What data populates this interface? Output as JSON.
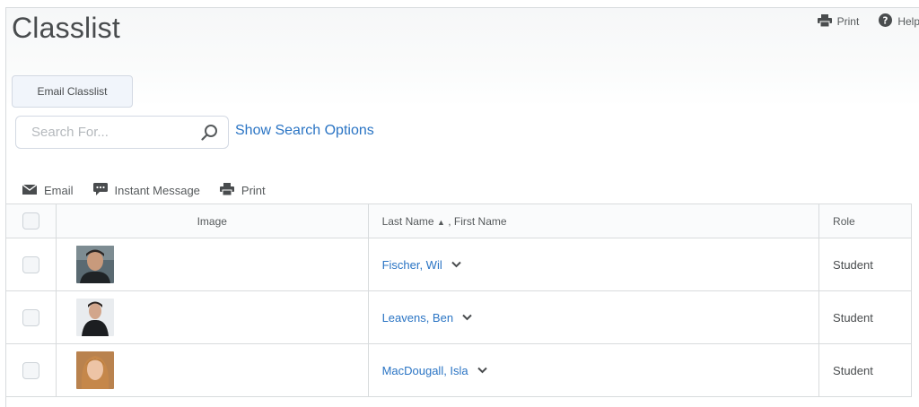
{
  "page": {
    "title": "Classlist",
    "top_actions": [
      {
        "label": "Print",
        "icon": "printer-icon"
      },
      {
        "label": "Help",
        "icon": "help-icon"
      }
    ],
    "email_classlist_label": "Email Classlist",
    "search": {
      "placeholder": "Search For...",
      "value": ""
    },
    "show_search_options": "Show Search Options"
  },
  "toolbar": {
    "email": "Email",
    "instant_message": "Instant Message",
    "print": "Print"
  },
  "table": {
    "headers": {
      "image": "Image",
      "last_name": "Last Name",
      "sort_indicator": "▲",
      "first_name": ", First Name",
      "role": "Role"
    },
    "rows": [
      {
        "name": "Fischer, Wil",
        "role": "Student"
      },
      {
        "name": "Leavens, Ben",
        "role": "Student"
      },
      {
        "name": "MacDougall, Isla",
        "role": "Student"
      }
    ]
  },
  "colors": {
    "link": "#2a74c4",
    "text": "#494c4e",
    "border": "#d8dbdd"
  }
}
